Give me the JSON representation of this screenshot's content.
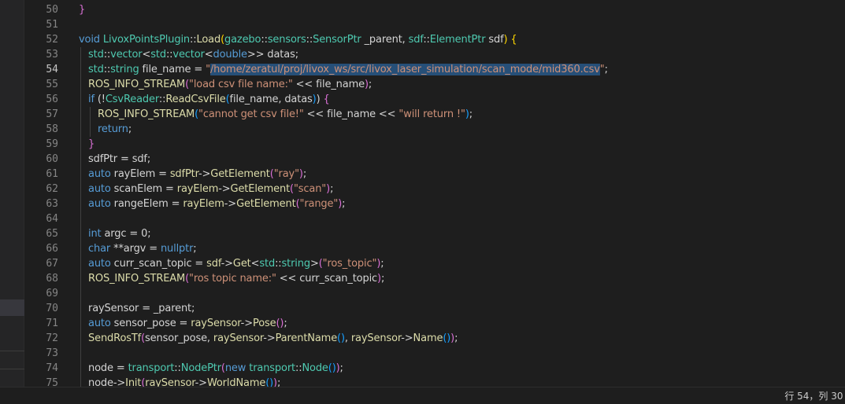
{
  "editor": {
    "active_line": 54,
    "line_numbers": [
      "50",
      "51",
      "52",
      "53",
      "54",
      "55",
      "56",
      "57",
      "58",
      "59",
      "60",
      "61",
      "62",
      "63",
      "64",
      "65",
      "66",
      "67",
      "68",
      "69",
      "70",
      "71",
      "72",
      "73",
      "74",
      "75"
    ],
    "lines": {
      "l50": [
        "}"
      ],
      "l52": [
        "void",
        " LivoxPointsPlugin",
        "::",
        "Load",
        "(",
        "gazebo",
        "::",
        "sensors",
        "::",
        "SensorPtr",
        " _parent, ",
        "sdf",
        "::",
        "ElementPtr",
        " sdf",
        ")",
        " {"
      ],
      "l53": [
        "std",
        "::",
        "vector",
        "<",
        "std",
        "::",
        "vector",
        "<",
        "double",
        ">> datas;"
      ],
      "l54": [
        "std",
        "::",
        "string",
        " file_name = ",
        "\"",
        "/home/zeratul/proj/livox_ws/src/livox_laser_simulation/scan_mode/mid360.csv",
        "\"",
        ";"
      ],
      "l55": [
        "ROS_INFO_STREAM",
        "(",
        "\"load csv file name:\"",
        " << file_name",
        ")",
        ";"
      ],
      "l56": [
        "if",
        " (!",
        "CsvReader",
        "::",
        "ReadCsvFile",
        "(",
        "file_name, datas",
        ")",
        ") ",
        "{"
      ],
      "l57": [
        "ROS_INFO_STREAM",
        "(",
        "\"cannot get csv file!\"",
        " << file_name << ",
        "\"will return !\"",
        ")",
        ";"
      ],
      "l58": [
        "return",
        ";"
      ],
      "l59": [
        "}"
      ],
      "l60": [
        "sdfPtr = sdf;"
      ],
      "l61": [
        "auto",
        " rayElem = ",
        "sdfPtr",
        "->",
        "GetElement",
        "(",
        "\"ray\"",
        ")",
        ";"
      ],
      "l62": [
        "auto",
        " scanElem = ",
        "rayElem",
        "->",
        "GetElement",
        "(",
        "\"scan\"",
        ")",
        ";"
      ],
      "l63": [
        "auto",
        " rangeElem = ",
        "rayElem",
        "->",
        "GetElement",
        "(",
        "\"range\"",
        ")",
        ";"
      ],
      "l65": [
        "int",
        " argc = 0;"
      ],
      "l66": [
        "char",
        " **argv = ",
        "nullptr",
        ";"
      ],
      "l67": [
        "auto",
        " curr_scan_topic = ",
        "sdf",
        "->",
        "Get",
        "<",
        "std",
        "::",
        "string",
        ">",
        "(",
        "\"ros_topic\"",
        ")",
        ";"
      ],
      "l68": [
        "ROS_INFO_STREAM",
        "(",
        "\"ros topic name:\"",
        " << curr_scan_topic",
        ")",
        ";"
      ],
      "l70": [
        "raySensor = _parent;"
      ],
      "l71": [
        "auto",
        " sensor_pose = ",
        "raySensor",
        "->",
        "Pose",
        "(",
        ")",
        ";"
      ],
      "l72": [
        "SendRosTf",
        "(",
        "sensor_pose, ",
        "raySensor",
        "->",
        "ParentName",
        "()",
        ", ",
        "raySensor",
        "->",
        "Name",
        "()",
        ")",
        ";"
      ],
      "l74": [
        "node = ",
        "transport",
        "::",
        "NodePtr",
        "(",
        "new",
        " ",
        "transport",
        "::",
        "Node",
        "()",
        ")",
        ";"
      ],
      "l75": [
        "node",
        "->",
        "Init",
        "(",
        "raySensor",
        "->",
        "WorldName",
        "()",
        ")",
        ";"
      ]
    }
  },
  "status_bar": {
    "cursor_position": "行 54，列 30 ("
  },
  "colors": {
    "background": "#1e1e1e",
    "keyword": "#569cd6",
    "type": "#4ec9b0",
    "function": "#dcdcaa",
    "string": "#ce9178",
    "selection": "#264f78"
  }
}
